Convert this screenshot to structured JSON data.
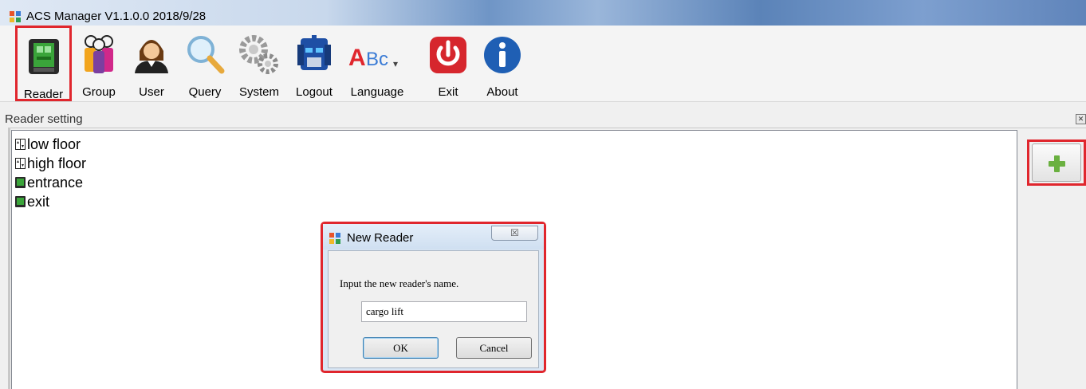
{
  "window": {
    "title": "ACS Manager V1.1.0.0  2018/9/28",
    "icon": "app-window-icon"
  },
  "toolbar": {
    "items": [
      {
        "label": "Reader",
        "icon": "reader-device-icon",
        "selected": true
      },
      {
        "label": "Group",
        "icon": "group-people-icon"
      },
      {
        "label": "User",
        "icon": "user-person-icon"
      },
      {
        "label": "Query",
        "icon": "magnifier-icon"
      },
      {
        "label": "System",
        "icon": "gears-icon"
      },
      {
        "label": "Logout",
        "icon": "robot-head-icon"
      },
      {
        "label": "Language",
        "icon": "abc-text-icon"
      },
      {
        "label": "Exit",
        "icon": "power-icon"
      },
      {
        "label": "About",
        "icon": "info-icon"
      }
    ]
  },
  "panel": {
    "title": "Reader setting",
    "readers": [
      {
        "name": "low floor",
        "icon": "elevator-icon"
      },
      {
        "name": "high floor",
        "icon": "elevator-icon"
      },
      {
        "name": "entrance",
        "icon": "door-reader-icon"
      },
      {
        "name": "exit",
        "icon": "door-reader-icon"
      }
    ],
    "add_button_icon": "plus-icon"
  },
  "dialog": {
    "title": "New Reader",
    "prompt": "Input the new reader's name.",
    "input_value": "cargo lift",
    "ok_label": "OK",
    "cancel_label": "Cancel",
    "close_glyph": "☒"
  },
  "colors": {
    "highlight": "#e0262d",
    "plus": "#6ab040"
  }
}
